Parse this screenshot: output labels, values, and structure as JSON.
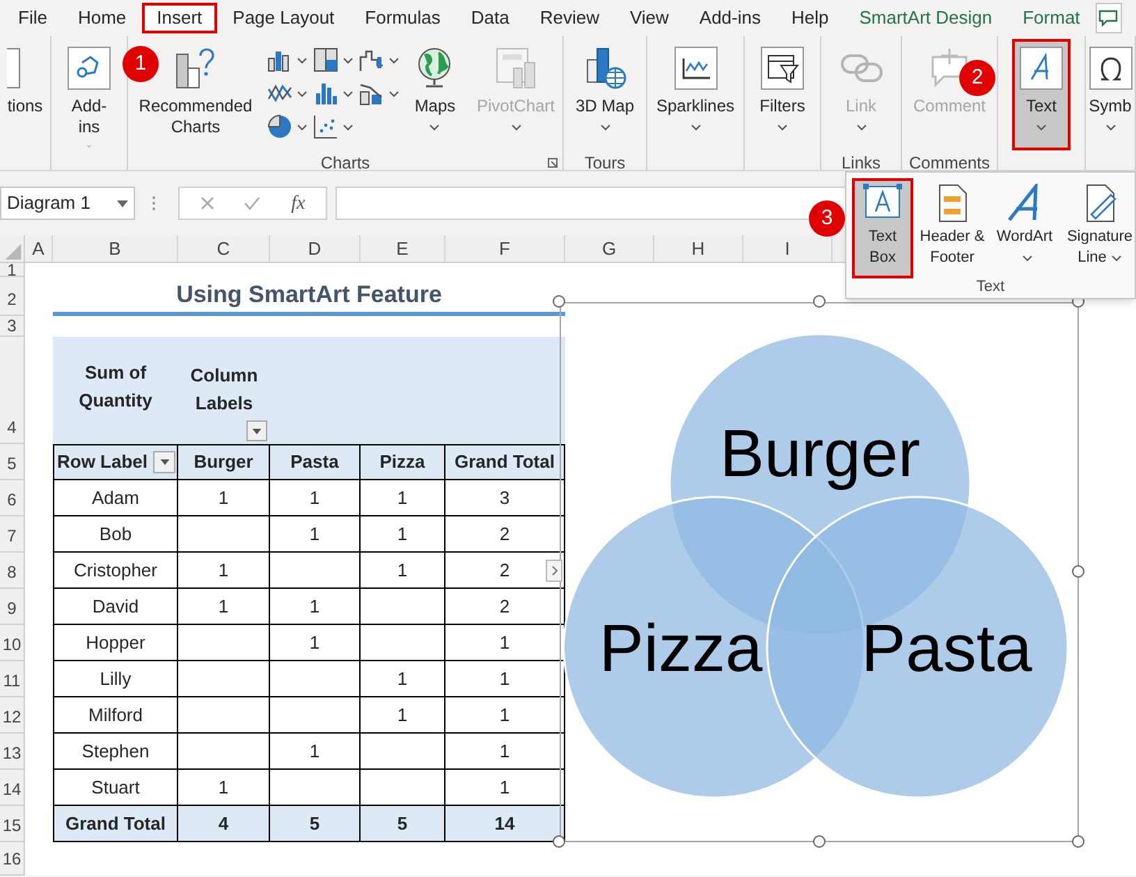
{
  "menu_tabs": [
    {
      "label": "File",
      "kind": "standard",
      "selected": false,
      "highlighted": false
    },
    {
      "label": "Home",
      "kind": "standard",
      "selected": false,
      "highlighted": false
    },
    {
      "label": "Insert",
      "kind": "standard",
      "selected": true,
      "highlighted": true,
      "callout": "1"
    },
    {
      "label": "Page Layout",
      "kind": "standard",
      "selected": false,
      "highlighted": false
    },
    {
      "label": "Formulas",
      "kind": "standard",
      "selected": false,
      "highlighted": false
    },
    {
      "label": "Data",
      "kind": "standard",
      "selected": false,
      "highlighted": false
    },
    {
      "label": "Review",
      "kind": "standard",
      "selected": false,
      "highlighted": false
    },
    {
      "label": "View",
      "kind": "standard",
      "selected": false,
      "highlighted": false
    },
    {
      "label": "Add-ins",
      "kind": "standard",
      "selected": false,
      "highlighted": false
    },
    {
      "label": "Help",
      "kind": "standard",
      "selected": false,
      "highlighted": false
    },
    {
      "label": "SmartArt Design",
      "kind": "contextual",
      "selected": false,
      "highlighted": false
    },
    {
      "label": "Format",
      "kind": "contextual",
      "selected": false,
      "highlighted": false
    }
  ],
  "ribbon_groups": [
    {
      "buttons": [
        {
          "label": "tions",
          "dropdown": false,
          "disabled": false,
          "selected": false,
          "highlighted": false
        }
      ]
    },
    {
      "buttons": [
        {
          "label": "Add-ins",
          "dropdown": true,
          "disabled": false,
          "selected": false,
          "highlighted": false
        }
      ]
    },
    {
      "label": "Charts",
      "launcher": true,
      "gallery": true,
      "buttons": [
        {
          "label": "Recommended Charts",
          "dropdown": false,
          "disabled": false,
          "selected": false,
          "highlighted": false
        },
        {
          "label": "Maps",
          "dropdown": true,
          "disabled": false,
          "selected": false,
          "highlighted": false
        },
        {
          "label": "PivotChart",
          "dropdown": true,
          "disabled": true,
          "selected": false,
          "highlighted": false
        }
      ]
    },
    {
      "label": "Tours",
      "buttons": [
        {
          "label": "3D Map",
          "dropdown": true,
          "disabled": false,
          "selected": false,
          "highlighted": false
        }
      ]
    },
    {
      "buttons": [
        {
          "label": "Sparklines",
          "dropdown": true,
          "disabled": false,
          "selected": false,
          "highlighted": false
        }
      ]
    },
    {
      "buttons": [
        {
          "label": "Filters",
          "dropdown": true,
          "disabled": false,
          "selected": false,
          "highlighted": false
        }
      ]
    },
    {
      "label": "Links",
      "buttons": [
        {
          "label": "Link",
          "dropdown": true,
          "disabled": true,
          "selected": false,
          "highlighted": false
        }
      ]
    },
    {
      "label": "Comments",
      "buttons": [
        {
          "label": "Comment",
          "dropdown": false,
          "disabled": true,
          "selected": false,
          "highlighted": false
        }
      ]
    },
    {
      "buttons": [
        {
          "label": "Text",
          "dropdown": true,
          "disabled": false,
          "selected": true,
          "highlighted": true,
          "callout": "2"
        }
      ]
    },
    {
      "buttons": [
        {
          "label": "Symb",
          "dropdown": true,
          "disabled": false,
          "selected": false,
          "highlighted": false
        }
      ]
    }
  ],
  "text_menu": {
    "label": "Text",
    "items": [
      {
        "label": "Text Box",
        "dropdown": false,
        "selected": true,
        "highlighted": true,
        "callout": "3"
      },
      {
        "label": "Header & Footer",
        "dropdown": false,
        "selected": false,
        "highlighted": false
      },
      {
        "label": "WordArt",
        "dropdown": true,
        "selected": false,
        "highlighted": false
      },
      {
        "label": "Signature Line",
        "dropdown": true,
        "selected": false,
        "highlighted": false
      }
    ]
  },
  "formula_bar": {
    "name_box": "Diagram 1",
    "function_label": "fx"
  },
  "sheet": {
    "columns": [
      "A",
      "B",
      "C",
      "D",
      "E",
      "F",
      "G",
      "H",
      "I"
    ],
    "rows": [
      "1",
      "2",
      "3",
      "4",
      "5",
      "6",
      "7",
      "8",
      "9",
      "10",
      "11",
      "12",
      "13",
      "14",
      "15",
      "16"
    ],
    "title": "Using SmartArt Feature",
    "pivot": {
      "value_label": "Sum of Quantity",
      "column_label": "Column Labels",
      "header": [
        "Row Label",
        "Burger",
        "Pasta",
        "Pizza",
        "Grand Total"
      ],
      "rows": [
        [
          "Adam",
          "1",
          "1",
          "1",
          "3"
        ],
        [
          "Bob",
          "",
          "1",
          "1",
          "2"
        ],
        [
          "Cristopher",
          "1",
          "",
          "1",
          "2"
        ],
        [
          "David",
          "1",
          "1",
          "",
          "2"
        ],
        [
          "Hopper",
          "",
          "1",
          "",
          "1"
        ],
        [
          "Lilly",
          "",
          "",
          "1",
          "1"
        ],
        [
          "Milford",
          "",
          "",
          "1",
          "1"
        ],
        [
          "Stephen",
          "",
          "1",
          "",
          "1"
        ],
        [
          "Stuart",
          "1",
          "",
          "",
          "1"
        ]
      ],
      "total": [
        "Grand Total",
        "4",
        "5",
        "5",
        "14"
      ]
    }
  },
  "smartart": {
    "selected": true,
    "circles": [
      {
        "label": "Burger"
      },
      {
        "label": "Pizza"
      },
      {
        "label": "Pasta"
      }
    ]
  }
}
